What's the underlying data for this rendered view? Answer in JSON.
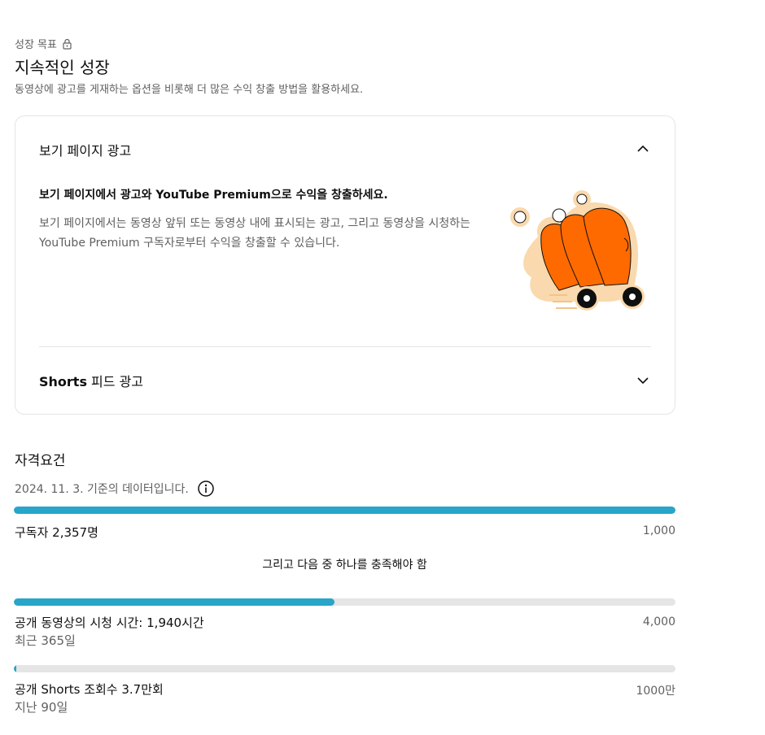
{
  "goal": {
    "label": "성장 목표",
    "title": "지속적인 성장",
    "subtitle": "동영상에 광고를 게재하는 옵션을 비롯해 더 많은 수익 창출 방법을 활용하세요."
  },
  "accordion": {
    "section1": {
      "header": "보기 페이지 광고",
      "expanded": true,
      "title": "보기 페이지에서 광고와 YouTube Premium으로 수익을 창출하세요.",
      "body": "보기 페이지에서는 동영상 앞뒤 또는 동영상 내에 표시되는 광고, 그리고 동영상을 시청하는 YouTube Premium 구독자로부터 수익을 창출할 수 있습니다."
    },
    "section2": {
      "header_bold": "Shorts",
      "header_rest": " 피드 광고",
      "expanded": false
    }
  },
  "requirements": {
    "title": "자격요건",
    "date_note": "2024. 11. 3. 기준의 데이터입니다.",
    "subscribers": {
      "label": "구독자 2,357명",
      "target": "1,000",
      "progress": 1.0
    },
    "connector": "그리고 다음 중 하나를 충족해야 함",
    "watch_time": {
      "label": "공개 동영상의 시청 시간: 1,940시간",
      "period": "최근 365일",
      "target": "4,000",
      "progress": 0.485
    },
    "shorts_views": {
      "label": "공개 Shorts 조회수 3.7만회",
      "period": "지난 90일",
      "target": "1000만",
      "progress": 0.0037
    }
  },
  "colors": {
    "progress": "#28a5c9",
    "track": "#e5e5e5",
    "illustration": "#ff6a00"
  }
}
